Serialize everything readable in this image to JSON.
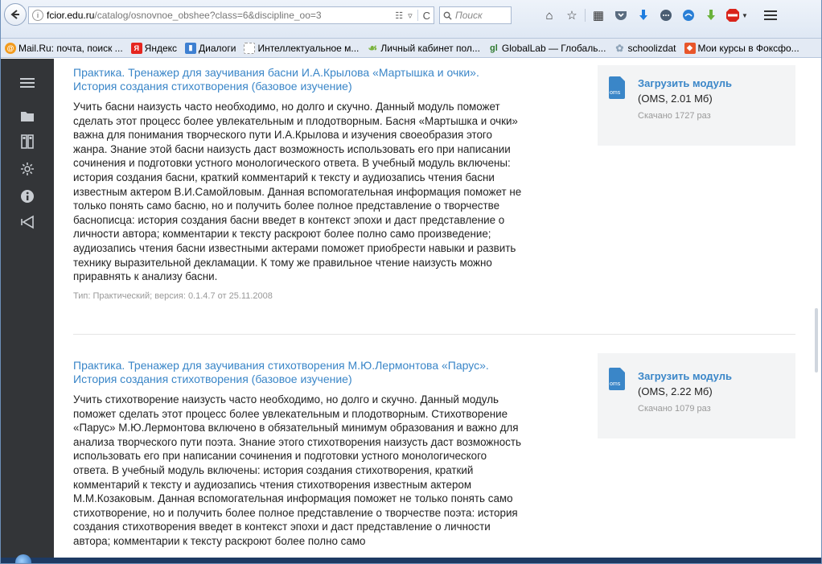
{
  "browser": {
    "url_host": "fcior.edu.ru",
    "url_path": "/catalog/osnovnoe_obshee?class=6&discipline_oo=3",
    "search_placeholder": "Поиск"
  },
  "bookmarks": [
    {
      "label": "Mail.Ru: почта, поиск ...",
      "icon": "mailru-icon",
      "color": "#f29b1d"
    },
    {
      "label": "Яндекс",
      "icon": "yandex-icon",
      "color": "#e52620"
    },
    {
      "label": "Диалоги",
      "icon": "dialogs-icon",
      "color": "#3d7fd1"
    },
    {
      "label": "Интеллектуальное м...",
      "icon": "page-icon",
      "color": "#bbbbbb"
    },
    {
      "label": "Личный кабинет пол...",
      "icon": "leaf-icon",
      "color": "#7ab33e"
    },
    {
      "label": "GlobalLab — Глобаль...",
      "icon": "globallab-icon",
      "color": "#2f7a2f"
    },
    {
      "label": "schoolizdat",
      "icon": "schoolizdat-icon",
      "color": "#8fa4b8"
    },
    {
      "label": "Мои курсы в Фоксфо...",
      "icon": "foxford-icon",
      "color": "#e8562a"
    }
  ],
  "modules": [
    {
      "title": "Практика. Тренажер для заучивания басни И.А.Крылова «Мартышка и очки». История создания стихотворения (базовое изучение)",
      "body": "Учить басни наизусть часто необходимо, но долго и скучно. Данный модуль поможет сделать этот процесс более увлекательным и плодотворным. Басня «Мартышка и очки» важна для понимания творческого пути И.А.Крылова и изучения своеобразия этого жанра. Знание этой басни наизусть даст возможность использовать его при написании сочинения и подготовки устного монологического ответа. В учебный модуль включены: история создания басни, краткий комментарий к тексту и аудиозапись чтения басни известным актером В.И.Самойловым. Данная вспомогательная информация поможет не только понять само басню, но и получить более полное представление о творчестве баснописца: история создания басни введет в контекст эпохи и даст представление о личности автора; комментарии к тексту раскроют более полно само произведение; аудиозапись чтения басни известными актерами поможет приобрести навыки и развить технику выразительной декламации. К тому же правильное чтение наизусть можно приравнять к анализу басни.",
      "meta": "Тип: Практический; версия: 0.1.4.7 от 25.11.2008",
      "download_label": "Загрузить модуль",
      "file_info": "(OMS, 2.01 Мб)",
      "downloads": "Скачано 1727 раз",
      "file_badge": "oms"
    },
    {
      "title": "Практика. Тренажер для заучивания стихотворения М.Ю.Лермонтова «Парус». История создания стихотворения (базовое изучение)",
      "body": "Учить стихотворение наизусть часто необходимо, но долго и скучно. Данный модуль поможет сделать этот процесс более увлекательным и плодотворным. Стихотворение «Парус» М.Ю.Лермонтова включено в обязательный минимум образования и важно для анализа творческого пути поэта. Знание этого стихотворения наизусть даст возможность использовать его при написании сочинения и подготовки устного монологического ответа. В учебный модуль включены: история создания стихотворения, краткий комментарий к тексту и аудиозапись чтения стихотворения известным актером М.М.Козаковым. Данная вспомогательная информация поможет не только понять само стихотворение, но и получить более полное представление о творчестве поэта: история создания стихотворения введет в контекст эпохи и даст представление о личности автора; комментарии к тексту раскроют более полно само",
      "download_label": "Загрузить модуль",
      "file_info": "(OMS, 2.22 Мб)",
      "downloads": "Скачано 1079 раз",
      "file_badge": "oms"
    }
  ]
}
